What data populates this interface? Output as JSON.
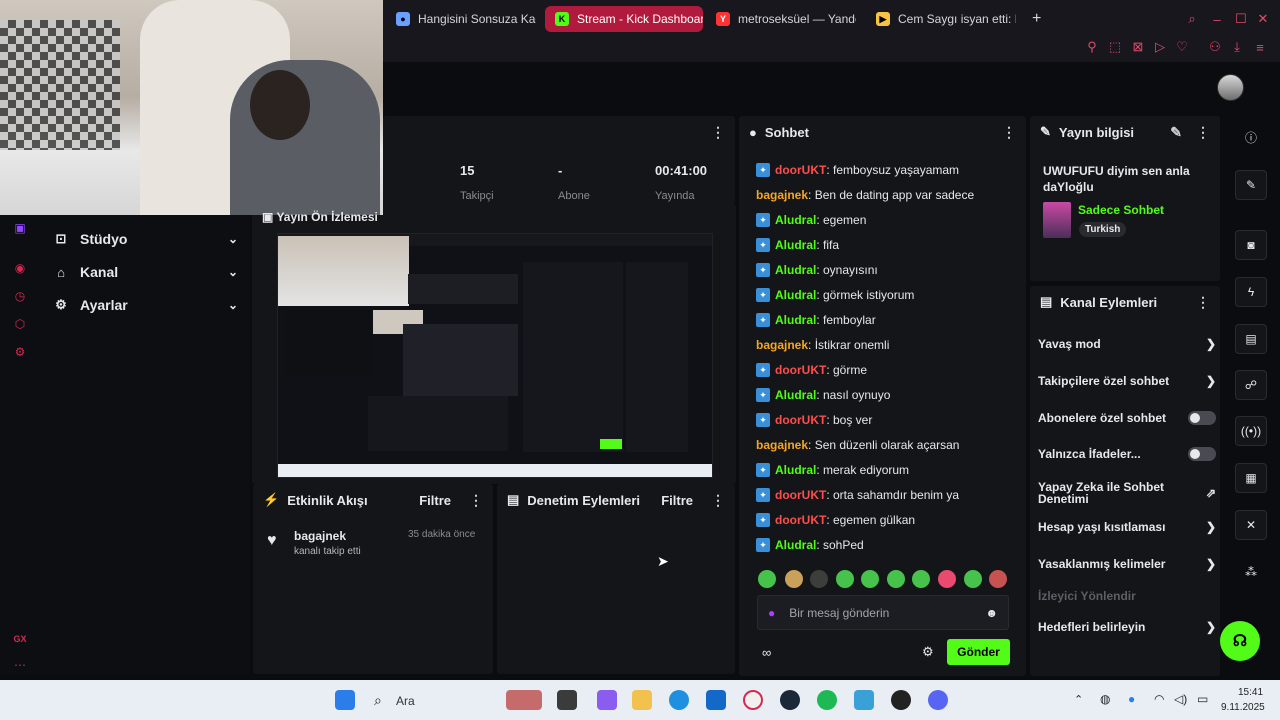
{
  "browser": {
    "tabs": [
      {
        "title": "Hangisini Sonsuza Kadar",
        "fav": "●",
        "active": false
      },
      {
        "title": "Stream - Kick Dashboard",
        "fav": "K",
        "active": true
      },
      {
        "title": "metroseksüel — Yandex:",
        "fav": "Y",
        "active": false
      },
      {
        "title": "Cem Saygı isyan etti: Hay",
        "fav": "▶",
        "active": false
      }
    ],
    "new_tab": "+"
  },
  "dashboard": {
    "stats": [
      {
        "value": "15",
        "label": "Takipçi"
      },
      {
        "value": "-",
        "label": "Abone"
      },
      {
        "value": "00:41:00",
        "label": "Yayında"
      }
    ],
    "preview_title": "Yayın Ön İzlemesi",
    "nav": [
      {
        "label": "Stüdyo",
        "icon": "studio-icon"
      },
      {
        "label": "Kanal",
        "icon": "channel-icon"
      },
      {
        "label": "Ayarlar",
        "icon": "settings-icon"
      }
    ],
    "rail_bottom": "GX"
  },
  "activity": {
    "title": "Etkinlik Akışı",
    "filter": "Filtre",
    "items": [
      {
        "user": "bagajnek",
        "text": "kanalı takip etti",
        "time": "35 dakika önce"
      }
    ]
  },
  "moderation": {
    "title": "Denetim Eylemleri",
    "filter": "Filtre"
  },
  "chat": {
    "title": "Sohbet",
    "messages": [
      {
        "user": "doorUKT",
        "color": "#ff4d4d",
        "badge": true,
        "text": ": femboysuz yaşayamam"
      },
      {
        "user": "bagajnek",
        "color": "#f5a623",
        "badge": false,
        "text": ": Ben de dating app var sadece"
      },
      {
        "user": "Aludral",
        "color": "#53fc18",
        "badge": true,
        "text": ": egemen"
      },
      {
        "user": "Aludral",
        "color": "#53fc18",
        "badge": true,
        "text": ": fifa"
      },
      {
        "user": "Aludral",
        "color": "#53fc18",
        "badge": true,
        "text": ": oynayısını"
      },
      {
        "user": "Aludral",
        "color": "#53fc18",
        "badge": true,
        "text": ": görmek istiyorum"
      },
      {
        "user": "Aludral",
        "color": "#53fc18",
        "badge": true,
        "text": ": femboylar"
      },
      {
        "user": "bagajnek",
        "color": "#f5a623",
        "badge": false,
        "text": ": İstikrar onemli"
      },
      {
        "user": "doorUKT",
        "color": "#ff4d4d",
        "badge": true,
        "text": ": görme"
      },
      {
        "user": "Aludral",
        "color": "#53fc18",
        "badge": true,
        "text": ": nasıl oynuyo"
      },
      {
        "user": "doorUKT",
        "color": "#ff4d4d",
        "badge": true,
        "text": ": boş ver"
      },
      {
        "user": "bagajnek",
        "color": "#f5a623",
        "badge": false,
        "text": ": Sen düzenli olarak açarsan"
      },
      {
        "user": "Aludral",
        "color": "#53fc18",
        "badge": true,
        "text": ": merak ediyorum"
      },
      {
        "user": "doorUKT",
        "color": "#ff4d4d",
        "badge": true,
        "text": ": orta sahamdır benim ya"
      },
      {
        "user": "doorUKT",
        "color": "#ff4d4d",
        "badge": true,
        "text": ": egemen gülkan"
      },
      {
        "user": "Aludral",
        "color": "#53fc18",
        "badge": true,
        "text": ": sohPed"
      }
    ],
    "input_placeholder": "Bir mesaj gönderin",
    "send": "Gönder"
  },
  "stream_info": {
    "title": "Yayın bilgisi",
    "stream_title": "UWUFUFU diyim sen anla daYloğlu",
    "category": "Sadece Sohbet",
    "tag": "Turkish"
  },
  "channel_actions": {
    "title": "Kanal Eylemleri",
    "items": [
      {
        "label": "Yavaş mod",
        "type": "chevron"
      },
      {
        "label": "Takipçilere özel sohbet",
        "type": "chevron"
      },
      {
        "label": "Abonelere özel sohbet",
        "type": "toggle"
      },
      {
        "label": "Yalnızca İfadeler...",
        "type": "toggle"
      },
      {
        "label": "Yapay Zeka ile Sohbet Denetimi",
        "type": "external"
      },
      {
        "label": "Hesap yaşı kısıtlaması",
        "type": "chevron"
      },
      {
        "label": "Yasaklanmış kelimeler",
        "type": "chevron"
      },
      {
        "label": "İzleyici Yönlendir",
        "type": "disabled"
      },
      {
        "label": "Hedefleri belirleyin",
        "type": "chevron"
      }
    ]
  },
  "taskbar": {
    "search": "Ara",
    "time": "15:41",
    "date": "9.11.2025"
  },
  "colors": {
    "kick_green": "#53fc18",
    "accent_red": "#b01b3d"
  }
}
